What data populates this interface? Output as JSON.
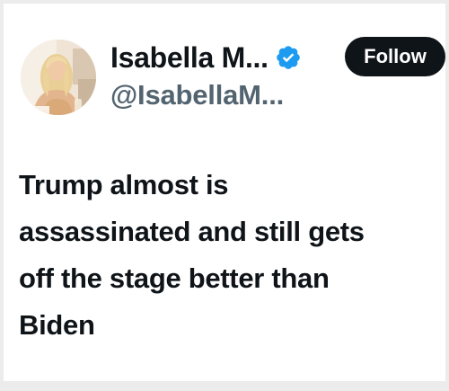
{
  "user": {
    "display_name": "Isabella M...",
    "handle": "@IsabellaM...",
    "verified": true,
    "verified_color": "#1d9bf0"
  },
  "follow_button": {
    "label": "Follow"
  },
  "tweet": {
    "lines": [
      "Trump almost is",
      "assassinated and still gets",
      "off the stage better than",
      "Biden"
    ]
  },
  "icons": {
    "verified": "verified-badge-icon",
    "avatar": "profile-avatar"
  }
}
